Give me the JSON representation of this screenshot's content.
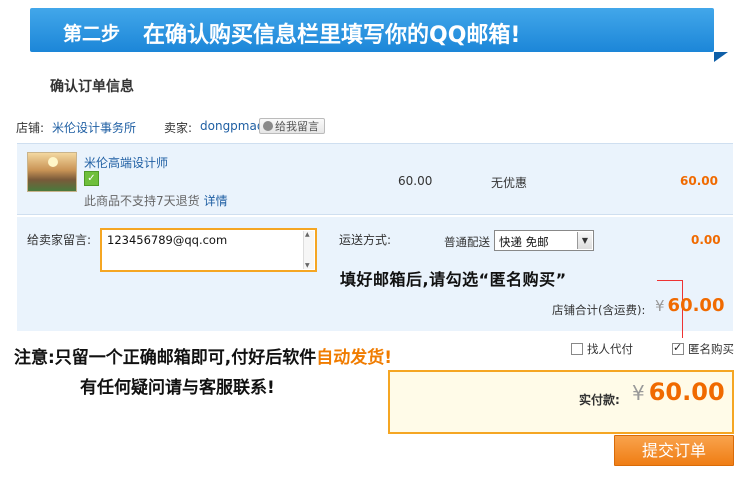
{
  "banner": {
    "step": "第二步",
    "title": "在确认购买信息栏里填写你的QQ邮箱!"
  },
  "section_title": "确认订单信息",
  "shop": {
    "shop_label": "店铺:",
    "shop_name": "米伦设计事务所",
    "seller_label": "卖家:",
    "seller_name": "dongpmao",
    "message_button": "给我留言"
  },
  "item": {
    "title": "米伦高端设计师",
    "badge_icon": "seller-badge-icon",
    "return_note": "此商品不支持7天退货",
    "details_link": "详情",
    "unit_price": "60.00",
    "discount": "无优惠",
    "subtotal": "60.00"
  },
  "order": {
    "leave_message_label": "给卖家留言:",
    "leave_message_value": "123456789@qq.com",
    "shipping_label": "运送方式:",
    "shipping_normal": "普通配送",
    "shipping_select": "快递 免邮",
    "shipping_fee": "0.00",
    "shop_total_label": "店铺合计(含运费):",
    "currency": "¥",
    "shop_total_value": "60.00"
  },
  "annotations": {
    "tip": "填好邮箱后,请勾选“匿名购买”",
    "notice_part1": "注意:只留一个正确邮箱即可,付好后软件",
    "notice_highlight": "自动发货!",
    "notice_line2": "有任何疑问请与客服联系!"
  },
  "options": {
    "proxy_pay": "找人代付",
    "proxy_pay_checked": false,
    "anonymous": "匿名购买",
    "anonymous_checked": true
  },
  "payment": {
    "label": "实付款:",
    "currency": "¥",
    "value": "60.00",
    "submit": "提交订单"
  },
  "colors": {
    "accent": "#f06a00",
    "banner": "#1c86d8",
    "highlight_border": "#f5a623",
    "link": "#1f5fa3"
  }
}
